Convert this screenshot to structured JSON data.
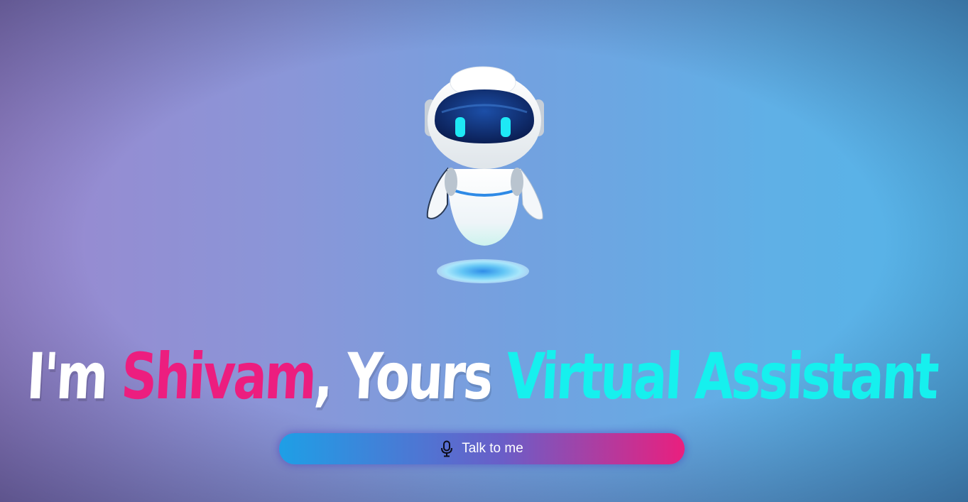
{
  "hero": {
    "illustration_icon": "robot-icon",
    "headline": {
      "part1": "I'm ",
      "name": "Shivam",
      "part2": ", Yours ",
      "role": "Virtual Assistant"
    },
    "talk_button": {
      "label": "Talk to me",
      "icon": "microphone-icon"
    }
  },
  "colors": {
    "name_pink": "#ec1e7f",
    "role_cyan": "#16f0ee",
    "button_start": "#1e9fe6",
    "button_end": "#ea1f7e"
  }
}
